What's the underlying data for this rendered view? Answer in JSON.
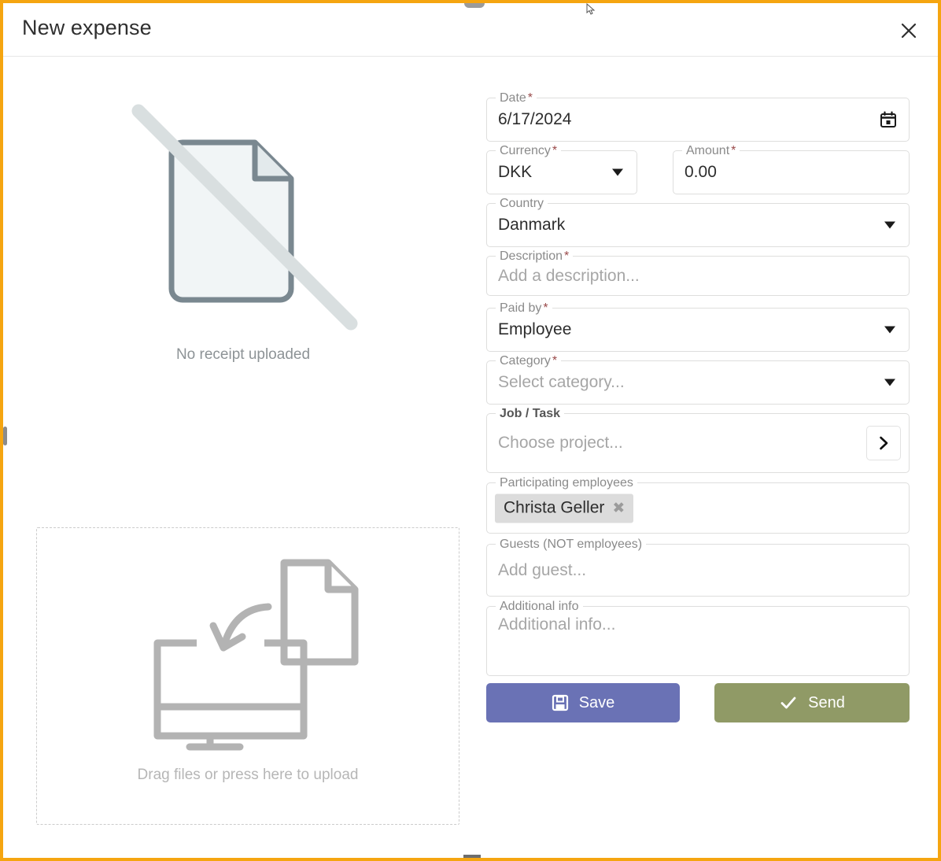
{
  "window": {
    "accent_border_color": "#f5a510"
  },
  "header": {
    "title": "New expense",
    "close_icon": "close-icon"
  },
  "receipt_pane": {
    "empty_state_label": "No receipt uploaded",
    "empty_state_icon": "document-slashed-icon",
    "dropzone": {
      "label": "Drag files or press here to upload",
      "icon": "drag-file-to-monitor-icon"
    }
  },
  "form": {
    "date": {
      "label": "Date",
      "required": true,
      "value": "6/17/2024",
      "icon": "calendar-icon"
    },
    "currency": {
      "label": "Currency",
      "required": true,
      "value": "DKK",
      "icon": "chevron-down-icon"
    },
    "amount": {
      "label": "Amount",
      "required": true,
      "value": "0.00"
    },
    "country": {
      "label": "Country",
      "required": false,
      "value": "Danmark",
      "icon": "chevron-down-icon"
    },
    "description": {
      "label": "Description",
      "required": true,
      "value": "",
      "placeholder": "Add a description..."
    },
    "paid_by": {
      "label": "Paid by",
      "required": true,
      "value": "Employee",
      "icon": "chevron-down-icon"
    },
    "category": {
      "label": "Category",
      "required": true,
      "value": "",
      "placeholder": "Select category...",
      "icon": "chevron-down-icon"
    },
    "job_task": {
      "label": "Job / Task",
      "required": false,
      "value": "",
      "placeholder": "Choose project...",
      "icon": "chevron-right-icon"
    },
    "participating_employees": {
      "label": "Participating employees",
      "required": false,
      "chips": [
        {
          "name": "Christa Geller",
          "remove_icon": "remove-chip-icon"
        }
      ]
    },
    "guests": {
      "label": "Guests (NOT employees)",
      "required": false,
      "value": "",
      "placeholder": "Add guest..."
    },
    "additional_info": {
      "label": "Additional info",
      "required": false,
      "value": "",
      "placeholder": "Additional info..."
    }
  },
  "actions": {
    "save": {
      "label": "Save",
      "icon": "floppy-disk-icon",
      "color": "#6a72b5"
    },
    "send": {
      "label": "Send",
      "icon": "check-icon",
      "color": "#909a66"
    }
  }
}
